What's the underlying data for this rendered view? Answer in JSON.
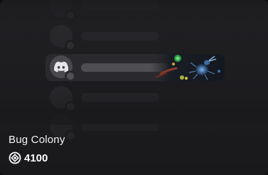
{
  "item": {
    "title": "Bug Colony",
    "price": "4100",
    "currency_icon": "orb-currency-icon",
    "preview_icon": "discord-logo-icon"
  },
  "colors": {
    "card_background": "#1e1e21",
    "text_primary": "#f2f3f5",
    "placeholder": "#2d2d31",
    "highlight_row": "#2a2a2e"
  }
}
